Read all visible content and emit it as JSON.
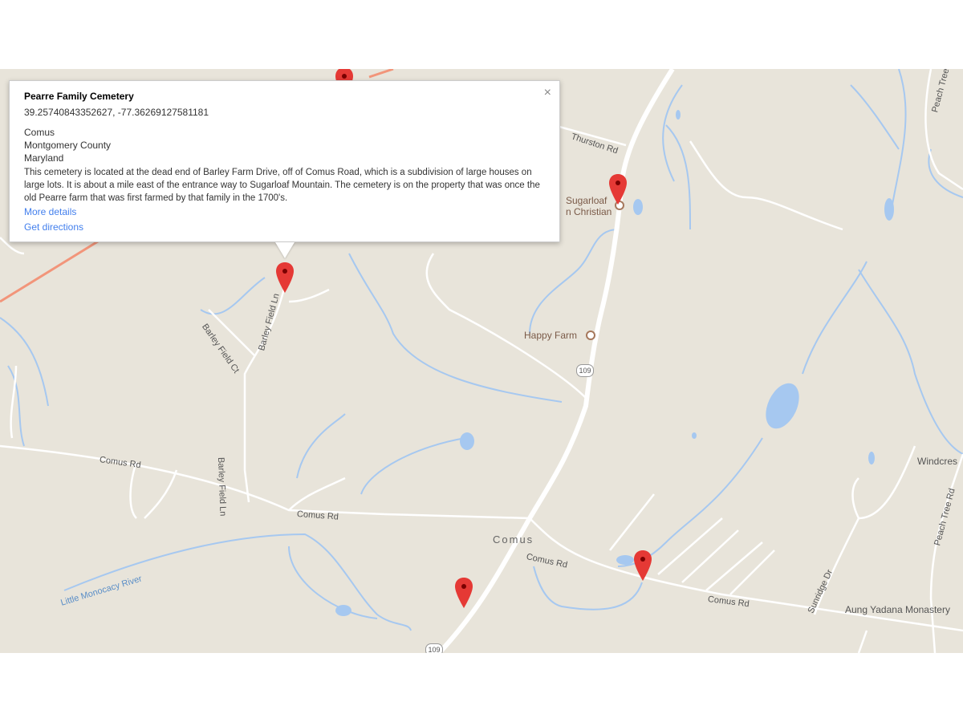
{
  "info_window": {
    "title": "Pearre Family Cemetery",
    "coords": "39.25740843352627, -77.36269127581181",
    "town": "Comus",
    "county": "Montgomery County",
    "state": "Maryland",
    "description": "This cemetery is located at the dead end of Barley Farm Drive, off of Comus Road, which is a subdivision of large houses on large lots. It is about a mile east of the entrance way to Sugarloaf Mountain. The cemetery is on the property that was once the old Pearre farm that was first farmed by that family in the 1700's.",
    "more_details": "More details",
    "get_directions": "Get directions",
    "close_icon": "close-icon",
    "close_glyph": "×"
  },
  "map": {
    "colors": {
      "land": "#e8e4da",
      "road": "#ffffff",
      "water": "#a6c8f0",
      "highway_red": "#f2957a",
      "pin": "#e53935"
    },
    "labels": {
      "thurston_rd": "Thurston Rd",
      "barley_field_ln_1": "Barley Field Ln",
      "barley_field_ct": "Barley Field Ct",
      "barley_field_ln_2": "Barley Field Ln",
      "comus_rd_1": "Comus Rd",
      "comus_rd_2": "Comus Rd",
      "comus_rd_3": "Comus Rd",
      "comus_rd_4": "Comus Rd",
      "little_monocacy": "Little Monocacy River",
      "sunridge_dr": "Sunridge Dr",
      "peach_tree_rd_1": "Peach Tree Rd",
      "peach_tree_rd_2": "Peach Tree Rd",
      "comus_town": "Comus",
      "sugarloaf_1": "Sugarloaf",
      "sugarloaf_2": "n Christian",
      "happy_farm": "Happy Farm",
      "windcrest": "Windcres",
      "aung_yadana": "Aung Yadana Monastery",
      "route_109_a": "109",
      "route_109_b": "109"
    }
  }
}
